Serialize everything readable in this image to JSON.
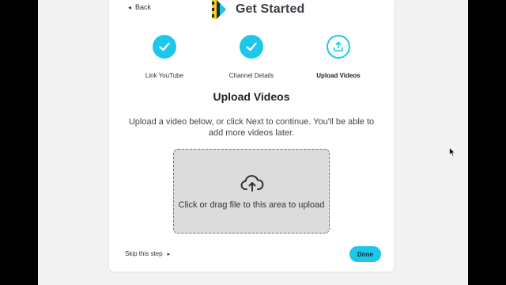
{
  "header": {
    "back_label": "Back",
    "title": "Get Started"
  },
  "steps": [
    {
      "label": "Link YouTube",
      "state": "done",
      "icon": "check-icon"
    },
    {
      "label": "Channel Details",
      "state": "done",
      "icon": "check-icon"
    },
    {
      "label": "Upload Videos",
      "state": "current",
      "icon": "upload-icon"
    }
  ],
  "main": {
    "heading": "Upload Videos",
    "description": "Upload a video below, or click Next to continue. You'll be able to add more videos later."
  },
  "dropzone": {
    "icon": "cloud-upload-icon",
    "text": "Click or drag file to this area to upload"
  },
  "footer": {
    "skip_label": "Skip this step",
    "done_label": "Done"
  },
  "colors": {
    "accent": "#1cc7ea",
    "logo_yellow": "#f2d21b",
    "logo_dark": "#1e2a3a"
  }
}
